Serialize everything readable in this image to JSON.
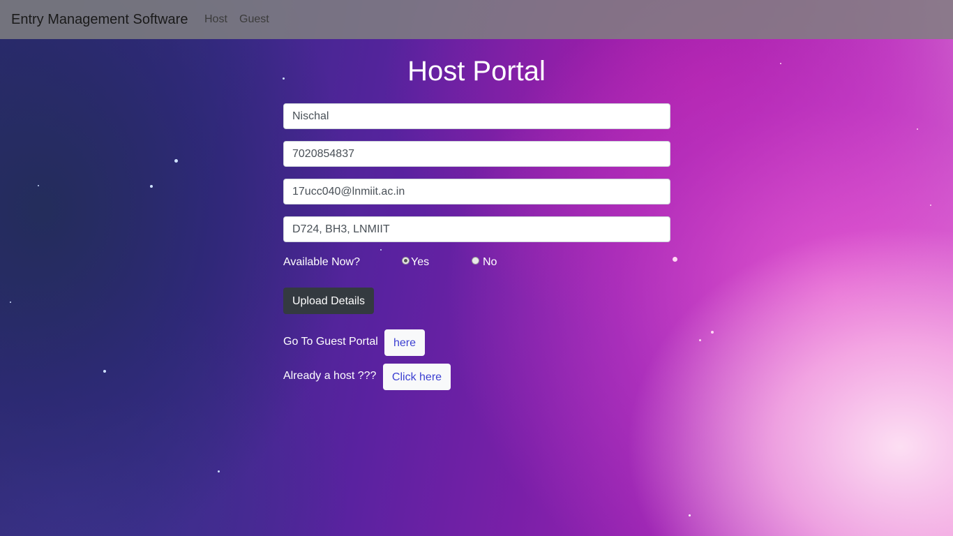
{
  "navbar": {
    "brand": "Entry Management Software",
    "links": [
      "Host",
      "Guest"
    ]
  },
  "page": {
    "title": "Host Portal"
  },
  "form": {
    "name_value": "Nischal",
    "phone_value": "7020854837",
    "email_value": "17ucc040@lnmiit.ac.in",
    "address_value": "D724, BH3, LNMIIT",
    "available_label": "Available Now?",
    "option_yes": "Yes",
    "option_no": "No",
    "available_selected": "Yes",
    "submit_label": "Upload Details"
  },
  "links": {
    "guest_prompt": "Go To Guest Portal",
    "guest_button": "here",
    "host_prompt": "Already a host ???",
    "host_button": "Click here"
  },
  "colors": {
    "navbar_bg": "#808080",
    "submit_bg": "#343a40",
    "link_button_text": "#3b3fd1"
  }
}
